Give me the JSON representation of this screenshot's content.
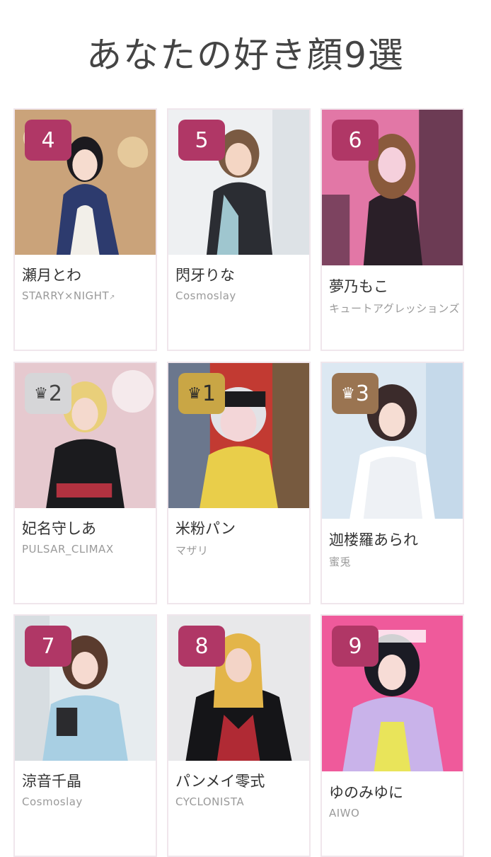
{
  "page": {
    "title": "あなたの好き顔9選"
  },
  "cards": [
    {
      "badge": "4",
      "name": "瀬月とわ",
      "group": "STARRY×NIGHT",
      "ext_icon": "external-link-icon",
      "rank_style": "magenta",
      "photo_tones": [
        "#caa37a",
        "#2d3b6e",
        "#f2efe9"
      ]
    },
    {
      "badge": "5",
      "name": "閃牙りな",
      "group": "Cosmoslay",
      "rank_style": "magenta",
      "photo_tones": [
        "#eef0f2",
        "#2b2d33",
        "#9fc6cf"
      ]
    },
    {
      "badge": "6",
      "name": "夢乃もこ",
      "group": "キュートアグレッションズ",
      "rank_style": "magenta",
      "photo_tones": [
        "#e277a6",
        "#2a1f28",
        "#f5d0dc"
      ]
    },
    {
      "badge": "2",
      "crown": "♛",
      "name": "妃名守しあ",
      "group": "PULSAR_CLIMAX",
      "rank_style": "silver",
      "photo_tones": [
        "#e6c9cf",
        "#1b1b1e",
        "#b23240"
      ]
    },
    {
      "badge": "1",
      "crown": "♛",
      "name": "米粉パン",
      "group": "マザリ",
      "rank_style": "gold",
      "photo_tones": [
        "#c23a32",
        "#31a0c9",
        "#e9ce4a"
      ]
    },
    {
      "badge": "3",
      "crown": "♛",
      "name": "迦楼羅あられ",
      "group": "蜜兎",
      "rank_style": "bronze",
      "photo_tones": [
        "#dce8f2",
        "#3b2b2b",
        "#ffffff"
      ]
    },
    {
      "badge": "7",
      "name": "涼音千晶",
      "group": "Cosmoslay",
      "rank_style": "magenta",
      "photo_tones": [
        "#e7ecef",
        "#a8cfe3",
        "#2b2b2e"
      ]
    },
    {
      "badge": "8",
      "name": "パンメイ零式",
      "group": "CYCLONISTA",
      "rank_style": "magenta",
      "photo_tones": [
        "#e8e8ea",
        "#151518",
        "#e3b549"
      ]
    },
    {
      "badge": "9",
      "name": "ゆのみゆに",
      "group": "AIWO",
      "rank_style": "magenta",
      "photo_tones": [
        "#ef5a9b",
        "#1b1b24",
        "#c9b3ea"
      ]
    }
  ]
}
